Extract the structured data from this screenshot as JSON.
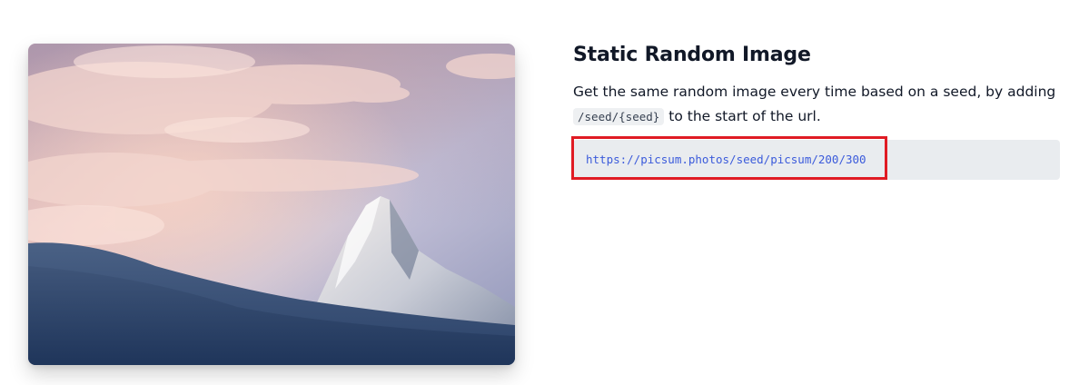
{
  "section": {
    "title": "Static Random Image",
    "description_before": "Get the same random image every time based on a seed, by adding",
    "inline_code": "/seed/{seed}",
    "description_after": "to the start of the url.",
    "url": "https://picsum.photos/seed/picsum/200/300"
  },
  "image": {
    "alt": "Snowy mountain peak at sunset with pink clouds"
  },
  "colors": {
    "highlight_border": "#e01b24",
    "url_text": "#3b5bdb",
    "code_background": "#e9ecef"
  }
}
